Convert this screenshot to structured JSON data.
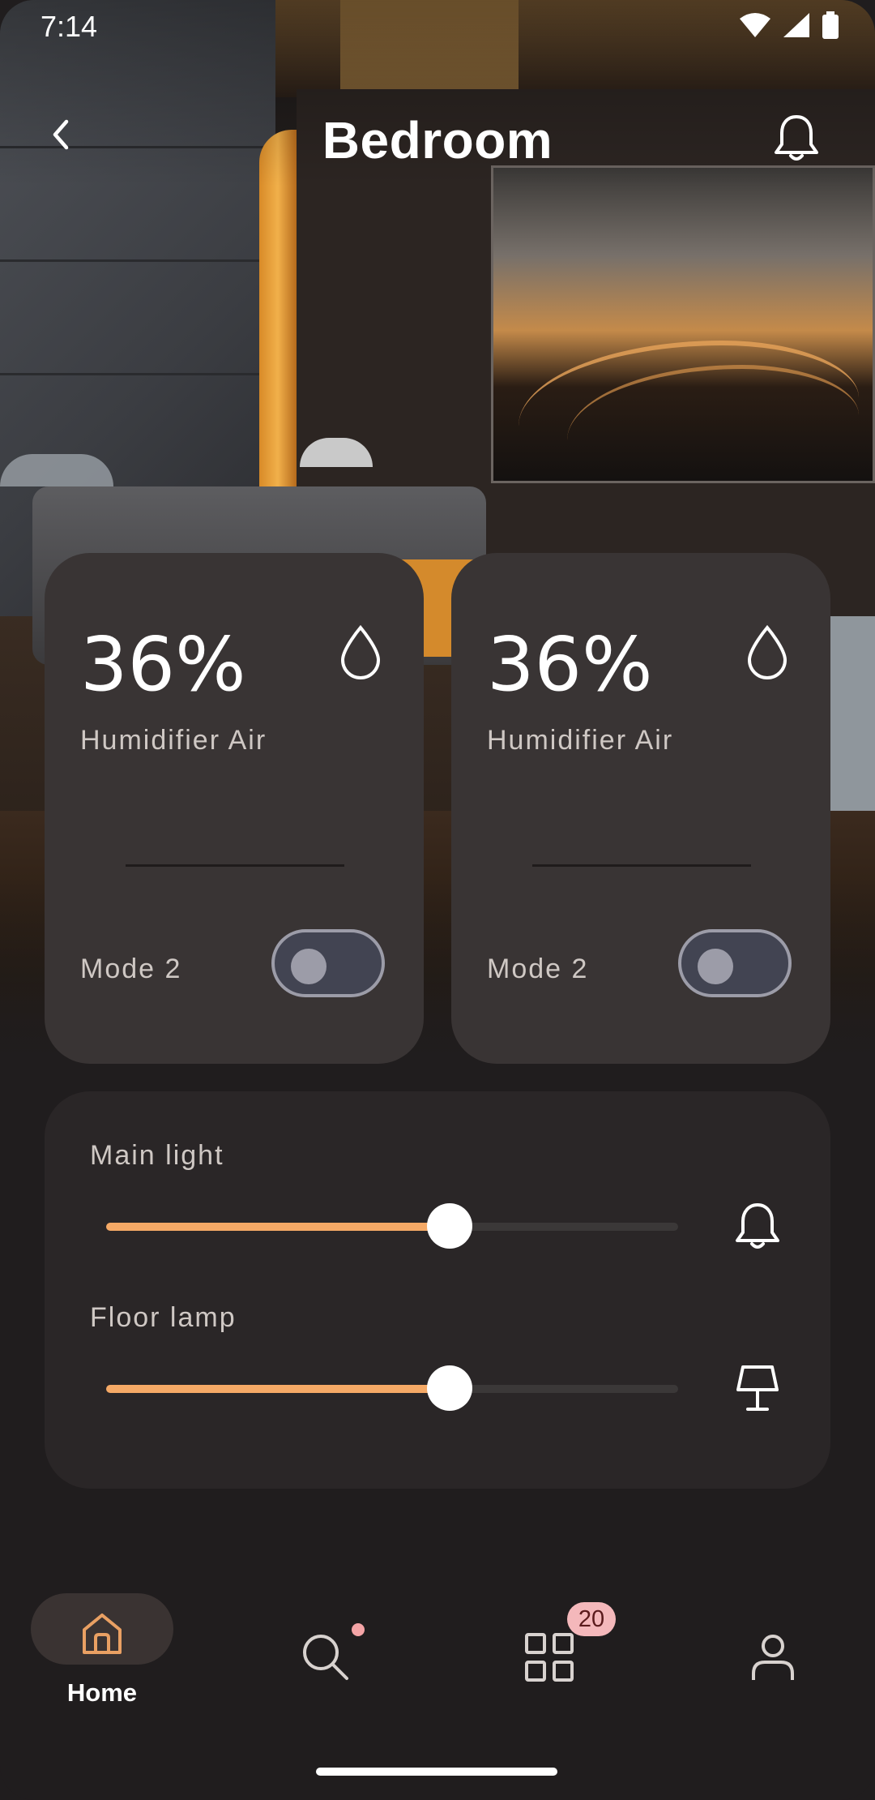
{
  "status_bar": {
    "time": "7:14",
    "icons": [
      "wifi-icon",
      "cell-signal-icon",
      "battery-icon"
    ]
  },
  "header": {
    "title": "Bedroom",
    "back_icon": "chevron-left-icon",
    "bell_icon": "bell-icon"
  },
  "devices": [
    {
      "value": "36%",
      "name": "Humidifier Air",
      "mode": "Mode 2",
      "icon": "droplet-icon",
      "toggle_on": false
    },
    {
      "value": "36%",
      "name": "Humidifier Air",
      "mode": "Mode 2",
      "icon": "droplet-icon",
      "toggle_on": false
    }
  ],
  "lights": [
    {
      "label": "Main light",
      "level_fraction": 0.6,
      "icon": "bell-icon"
    },
    {
      "label": "Floor lamp",
      "level_fraction": 0.6,
      "icon": "lamp-icon"
    }
  ],
  "bottom_nav": {
    "items": [
      {
        "label": "Home",
        "icon": "home-icon",
        "active": true
      },
      {
        "label": "",
        "icon": "search-icon",
        "dot": true
      },
      {
        "label": "",
        "icon": "grid-icon",
        "badge": "20"
      },
      {
        "label": "",
        "icon": "profile-icon"
      }
    ]
  },
  "colors": {
    "accent": "#f5a966",
    "card": "#393434",
    "panel": "#2a2627",
    "background": "#201d1e",
    "badge": "#f4b8bb"
  }
}
